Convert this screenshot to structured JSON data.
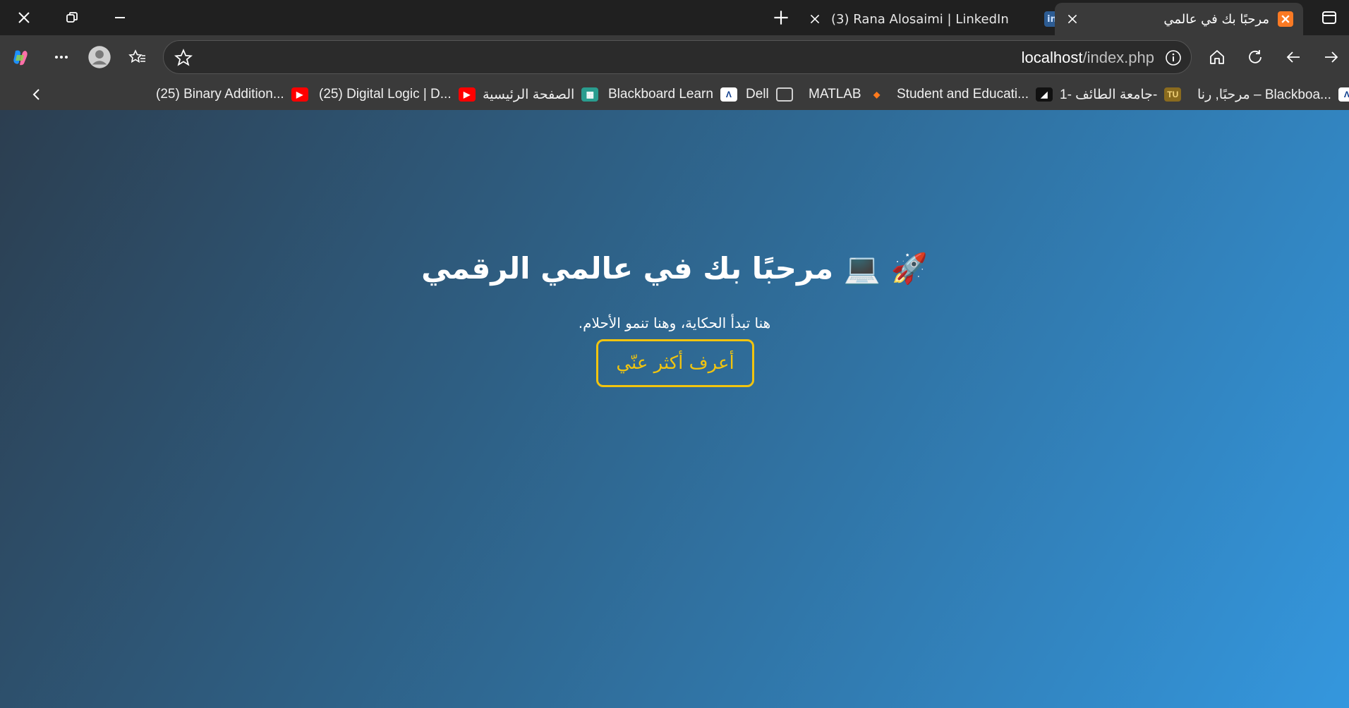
{
  "browser": {
    "tabs": [
      {
        "title": "(3) Rana Alosaimi | LinkedIn",
        "icon": "linkedin-icon"
      },
      {
        "title": "مرحبًا بك في عالمي",
        "icon": "xampp-icon",
        "active": true
      }
    ],
    "address": {
      "host": "localhost",
      "path": "/index.php"
    },
    "bookmarks": [
      {
        "label": "(25) Binary Addition...",
        "icon": "youtube-icon"
      },
      {
        "label": "(25) Digital Logic | D...",
        "icon": "youtube-icon"
      },
      {
        "label": "الصفحة الرئيسية",
        "icon": "university-icon"
      },
      {
        "label": "Blackboard Learn",
        "icon": "blackboard-icon"
      },
      {
        "label": "Dell",
        "icon": "folder-icon"
      },
      {
        "label": "MATLAB",
        "icon": "matlab-icon"
      },
      {
        "label": "Student and Educati...",
        "icon": "github-icon"
      },
      {
        "label": "جامعة الطائف -1-",
        "icon": "tu-icon"
      },
      {
        "label": "مرحبًا, رنا – Blackboa...",
        "icon": "blackboard-icon"
      }
    ],
    "favicon_glyphs": {
      "linkedin": "in",
      "blackboard": "Λ",
      "tu": "TU"
    },
    "colors": {
      "accent": "#f1c40f",
      "gradient_start": "#2c3e50",
      "gradient_end": "#3498db"
    }
  },
  "page": {
    "title": "🚀 💻 مرحبًا بك في عالمي الرقمي",
    "subtitle": ".هنا تبدأ الحكاية، وهنا تنمو الأحلام",
    "cta_label": "أعرف أكثر عنّي"
  }
}
